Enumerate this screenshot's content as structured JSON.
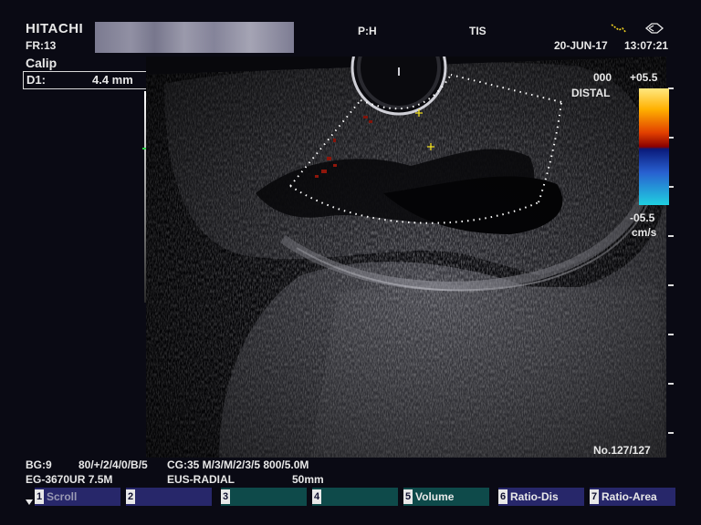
{
  "header": {
    "brand": "HITACHI",
    "frame_rate": "FR:13",
    "probe_ph": "P:H",
    "probe_tis": "TIS",
    "date": "20-JUN-17",
    "time": "13:07:21"
  },
  "caliper": {
    "title": "Calip",
    "d1_label": "D1:",
    "d1_value": "4.4 mm"
  },
  "color_scale": {
    "top": "+05.5",
    "zero": "000",
    "direction": "DISTAL",
    "bottom": "-05.5",
    "unit": "cm/s",
    "colors": [
      "#ffe880",
      "#ffb000",
      "#e24000",
      "#8a0000",
      "#0a1a7a",
      "#2860d0",
      "#20d0e0"
    ]
  },
  "frame_counter": "No.127/127",
  "params": {
    "bg": "BG:9",
    "line1_mid": "80/+/2/4/0/B/5",
    "line1_right": "CG:35  M/3/M/2/3/5 800/5.0M",
    "probe_model": "EG-3670UR 7.5M",
    "mode": "EUS-RADIAL",
    "depth": "50mm"
  },
  "softkeys": [
    {
      "num": "1",
      "label": "Scroll",
      "style": "blue"
    },
    {
      "num": "2",
      "label": "",
      "style": "blue"
    },
    {
      "num": "3",
      "label": "",
      "style": "teal"
    },
    {
      "num": "4",
      "label": "",
      "style": "teal"
    },
    {
      "num": "5",
      "label": "Volume",
      "style": "teal"
    },
    {
      "num": "6",
      "label": "Ratio-Dis",
      "style": "blue"
    },
    {
      "num": "7",
      "label": "Ratio-Area",
      "style": "blue"
    }
  ],
  "icons": {
    "scroll_indicator": "triangle-down-icon",
    "cursor": "pen-trace-icon",
    "pointer": "triangle-right-icon"
  }
}
